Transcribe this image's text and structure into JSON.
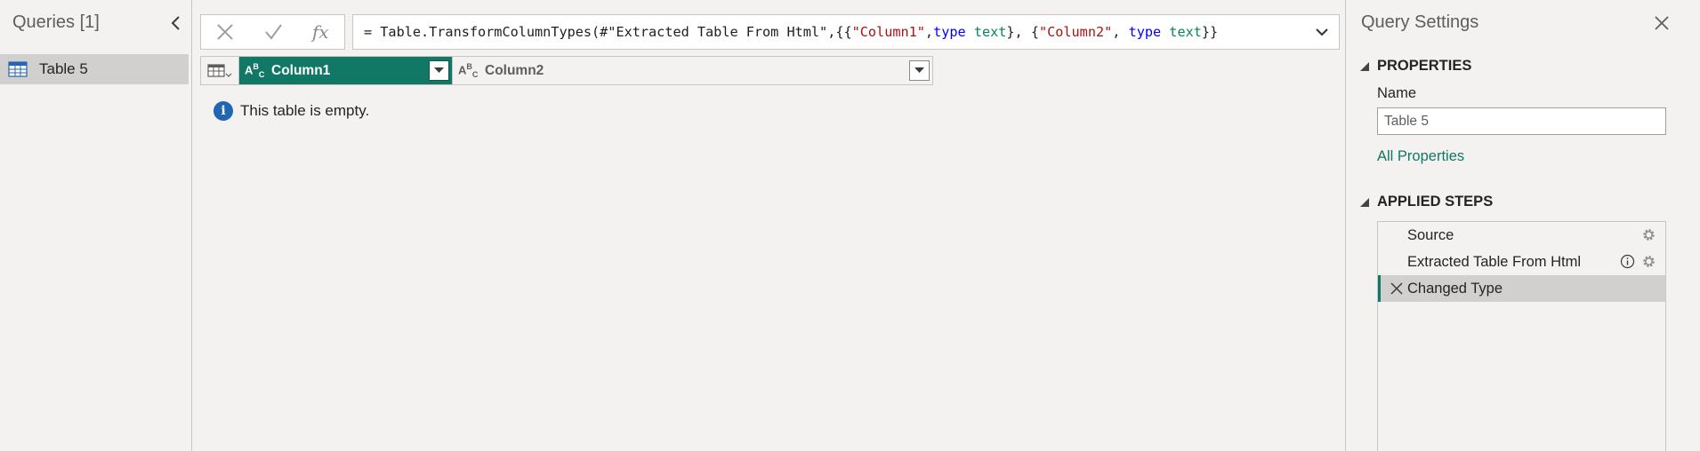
{
  "queries": {
    "header": "Queries [1]",
    "items": [
      {
        "label": "Table 5",
        "icon": "table-icon"
      }
    ]
  },
  "formula_bar": {
    "cancel_icon": "close-icon",
    "confirm_icon": "checkmark-icon",
    "fx_label": "fx",
    "tokens": [
      {
        "text": "= Table.TransformColumnTypes(#\"Extracted Table From Html\",{{",
        "kind": "plain"
      },
      {
        "text": "\"Column1\"",
        "kind": "string"
      },
      {
        "text": ", ",
        "kind": "plain"
      },
      {
        "text": "type",
        "kind": "keyword"
      },
      {
        "text": " ",
        "kind": "plain"
      },
      {
        "text": "text",
        "kind": "type"
      },
      {
        "text": "}, {",
        "kind": "plain"
      },
      {
        "text": "\"Column2\"",
        "kind": "string"
      },
      {
        "text": ", ",
        "kind": "plain"
      },
      {
        "text": "type",
        "kind": "keyword"
      },
      {
        "text": " ",
        "kind": "plain"
      },
      {
        "text": "text",
        "kind": "type"
      },
      {
        "text": "}}",
        "kind": "plain"
      }
    ]
  },
  "grid": {
    "columns": [
      {
        "name": "Column1",
        "type_icon": "ABC",
        "selected": true
      },
      {
        "name": "Column2",
        "type_icon": "ABC",
        "selected": false
      }
    ],
    "empty_message": "This table is empty."
  },
  "settings": {
    "title": "Query Settings",
    "properties_title": "PROPERTIES",
    "name_label": "Name",
    "name_value": "Table 5",
    "all_properties_link": "All Properties",
    "applied_steps_title": "APPLIED STEPS",
    "steps": [
      {
        "label": "Source",
        "has_gear": true,
        "has_info": false,
        "selected": false
      },
      {
        "label": "Extracted Table From Html",
        "has_gear": true,
        "has_info": true,
        "selected": false
      },
      {
        "label": "Changed Type",
        "has_gear": false,
        "has_info": false,
        "selected": true
      }
    ]
  },
  "colors": {
    "accent": "#117865",
    "background": "#f3f2f1",
    "selection": "#d2d0ce",
    "info_blue": "#2266b3",
    "string_red": "#a31515",
    "keyword_blue": "#0000ff",
    "type_teal": "#098658"
  }
}
